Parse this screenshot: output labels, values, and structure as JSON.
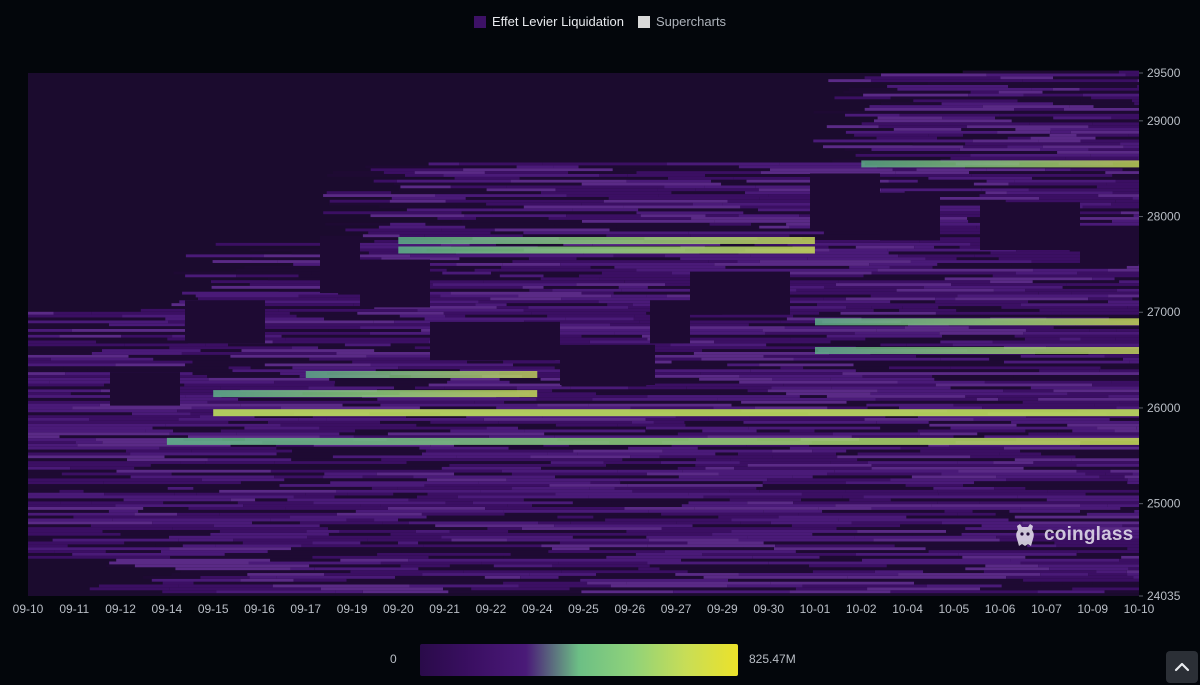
{
  "legend": {
    "items": [
      {
        "label": "Effet Levier Liquidation",
        "color": "#3d1166"
      },
      {
        "label": "Supercharts",
        "color": "#d9d9d9"
      }
    ]
  },
  "colorbar": {
    "min_label": "0",
    "max_label": "825.47M",
    "colors": [
      "#2a0b4a",
      "#3b0f63",
      "#4a1a78",
      "#6cbf85",
      "#8fd27a",
      "#c7dd57",
      "#ece22a"
    ]
  },
  "watermark": {
    "text": "coinglass"
  },
  "colors": {
    "background": "#03060b",
    "empty": "#1b0b2e",
    "low": "#3b0f63",
    "mid": "#4c1b79",
    "high": "#74c785",
    "max": "#e3e13a"
  },
  "chart_data": {
    "type": "heatmap",
    "title": "",
    "legend_position": "top-center",
    "x_ticks": [
      "09-10",
      "09-11",
      "09-12",
      "09-14",
      "09-15",
      "09-16",
      "09-17",
      "09-19",
      "09-20",
      "09-21",
      "09-22",
      "09-24",
      "09-25",
      "09-26",
      "09-27",
      "09-29",
      "09-30",
      "10-01",
      "10-02",
      "10-04",
      "10-05",
      "10-06",
      "10-07",
      "10-09",
      "10-10"
    ],
    "y_ticks": [
      29500,
      29000,
      28000,
      27000,
      26000,
      25000,
      24035
    ],
    "ylim": [
      24035,
      29500
    ],
    "value_range": [
      0,
      825470000
    ],
    "value_range_label": "825.47M",
    "high_bands": [
      {
        "price": 25950,
        "from": "09-15",
        "to": "10-10",
        "intensity": 0.85
      },
      {
        "price": 25650,
        "from": "09-14",
        "to": "10-10",
        "intensity": 0.7
      },
      {
        "price": 26150,
        "from": "09-15",
        "to": "09-24",
        "intensity": 0.65
      },
      {
        "price": 27650,
        "from": "09-20",
        "to": "10-01",
        "intensity": 0.7
      },
      {
        "price": 27750,
        "from": "09-20",
        "to": "10-01",
        "intensity": 0.6
      },
      {
        "price": 26900,
        "from": "10-01",
        "to": "10-10",
        "intensity": 0.6
      },
      {
        "price": 26600,
        "from": "10-01",
        "to": "10-10",
        "intensity": 0.55
      },
      {
        "price": 28550,
        "from": "10-02",
        "to": "10-10",
        "intensity": 0.55
      },
      {
        "price": 26350,
        "from": "09-17",
        "to": "09-24",
        "intensity": 0.5
      }
    ]
  }
}
